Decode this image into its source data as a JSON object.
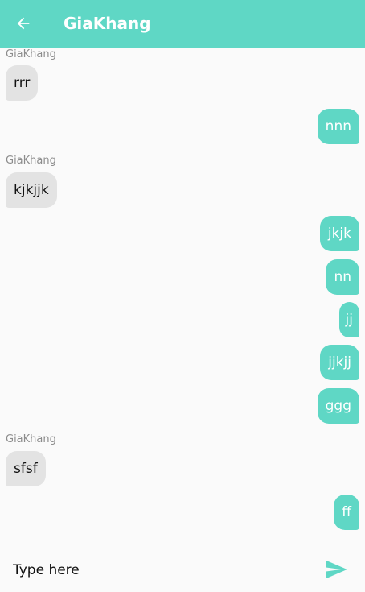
{
  "colors": {
    "accent": "#5fd7c5",
    "incoming_bubble": "#e3e3e3",
    "sender_text": "#8c8c8c"
  },
  "header": {
    "back_icon": "arrow-back-icon",
    "title": "GiaKhang"
  },
  "messages": [
    {
      "direction": "in",
      "sender": "GiaKhang",
      "text": "rrr"
    },
    {
      "direction": "out",
      "text": "nnn"
    },
    {
      "direction": "in",
      "sender": "GiaKhang",
      "text": "kjkjjk"
    },
    {
      "direction": "out",
      "text": "jkjk"
    },
    {
      "direction": "out",
      "text": "nn"
    },
    {
      "direction": "out",
      "text": "jj"
    },
    {
      "direction": "out",
      "text": "jjkjj"
    },
    {
      "direction": "out",
      "text": "ggg"
    },
    {
      "direction": "in",
      "sender": "GiaKhang",
      "text": "sfsf"
    },
    {
      "direction": "out",
      "text": "ff"
    }
  ],
  "composer": {
    "placeholder": "Type here",
    "value": "",
    "send_icon": "send-icon"
  }
}
